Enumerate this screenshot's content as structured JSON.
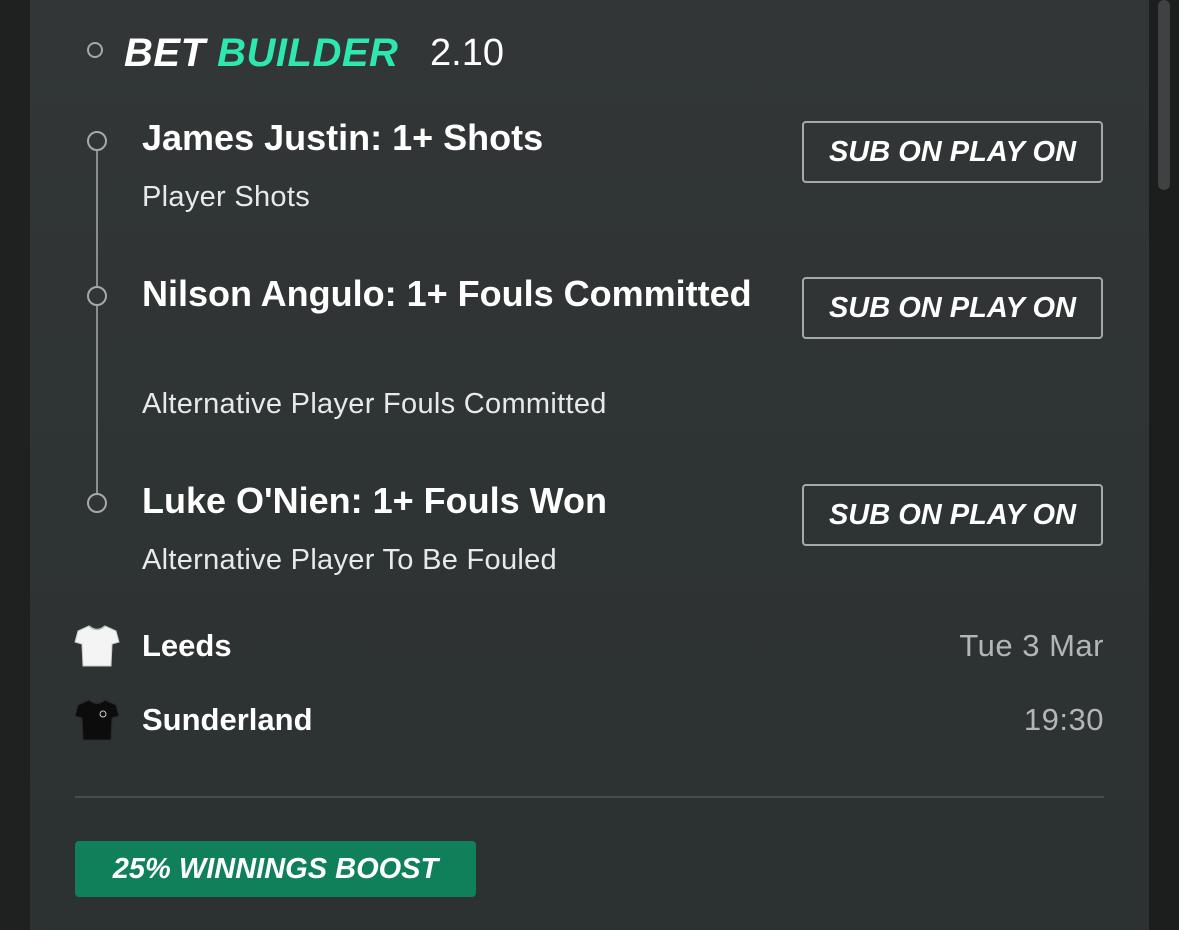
{
  "header": {
    "title_part1": "BET",
    "title_part2": "BUILDER",
    "odds": "2.10"
  },
  "legs": [
    {
      "title": "James Justin: 1+ Shots",
      "subtitle": "Player Shots",
      "button_label": "SUB ON PLAY ON"
    },
    {
      "title": "Nilson Angulo: 1+ Fouls Committed",
      "subtitle": "Alternative Player Fouls Committed",
      "button_label": "SUB ON PLAY ON"
    },
    {
      "title": "Luke O'Nien: 1+ Fouls Won",
      "subtitle": "Alternative Player To Be Fouled",
      "button_label": "SUB ON PLAY ON"
    }
  ],
  "match": {
    "home": {
      "name": "Leeds",
      "shirt_icon": "white-shirt-icon"
    },
    "away": {
      "name": "Sunderland",
      "shirt_icon": "black-shirt-icon"
    },
    "date": "Tue 3 Mar",
    "time": "19:30"
  },
  "promo": {
    "label": "25% WINNINGS BOOST"
  },
  "colors": {
    "accent": "#2ee6b0",
    "boost_bg": "#10805a",
    "panel_bg": "#313535"
  }
}
